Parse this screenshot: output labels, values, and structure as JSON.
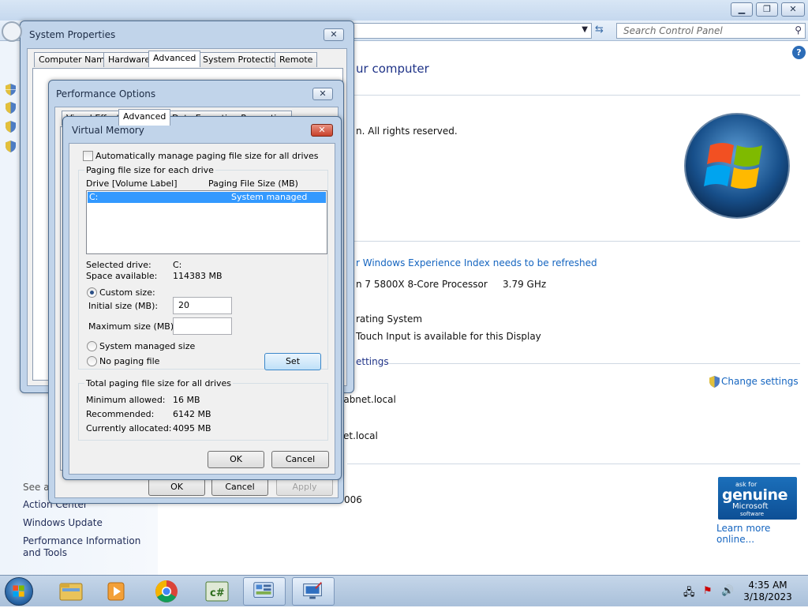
{
  "control_panel": {
    "search_placeholder": "Search Control Panel",
    "heading_fragment": "ur computer",
    "copyright_fragment": "n.  All rights reserved.",
    "wei_link_fragment": "r Windows Experience Index needs to be refreshed",
    "processor_fragment": "n 7 5800X 8-Core Processor",
    "processor_speed": "3.79 GHz",
    "os_fragment": "rating System",
    "touch_fragment": "Touch Input is available for this Display",
    "settings_fragment": "ettings",
    "change_settings": "Change settings",
    "domain_fragment_1": "labnet.local",
    "domain_fragment_2": "et.local",
    "product_id_fragment": "006",
    "left_see_also": "See al",
    "left_links": [
      "Action Center",
      "Windows Update",
      "Performance Information and Tools"
    ],
    "genuine": {
      "line1": "ask for",
      "line2": "genuine",
      "line3": "Microsoft",
      "line4": "software"
    },
    "learn_more": "Learn more online..."
  },
  "system_properties": {
    "title": "System Properties",
    "tabs": [
      "Computer Name",
      "Hardware",
      "Advanced",
      "System Protection",
      "Remote"
    ],
    "selected_tab": "Advanced"
  },
  "performance_options": {
    "title": "Performance Options",
    "tabs": [
      "Visual Effects",
      "Advanced",
      "Data Execution Prevention"
    ],
    "selected_tab": "Advanced",
    "buttons": {
      "ok": "OK",
      "cancel": "Cancel",
      "apply": "Apply"
    }
  },
  "virtual_memory": {
    "title": "Virtual Memory",
    "auto_manage_label": "Automatically manage paging file size for all drives",
    "auto_manage_checked": false,
    "paging_group_label": "Paging file size for each drive",
    "col_drive": "Drive  [Volume Label]",
    "col_size": "Paging File Size (MB)",
    "drives": [
      {
        "drive": "C:",
        "size": "System managed"
      }
    ],
    "selected_drive_label": "Selected drive:",
    "selected_drive_value": "C:",
    "space_available_label": "Space available:",
    "space_available_value": "114383 MB",
    "custom_size_label": "Custom size:",
    "initial_size_label": "Initial size (MB):",
    "initial_size_value": "20",
    "maximum_size_label": "Maximum size (MB):",
    "maximum_size_value": "",
    "system_managed_label": "System managed size",
    "no_paging_label": "No paging file",
    "set_button": "Set",
    "total_group_label": "Total paging file size for all drives",
    "minimum_label": "Minimum allowed:",
    "minimum_value": "16 MB",
    "recommended_label": "Recommended:",
    "recommended_value": "6142 MB",
    "allocated_label": "Currently allocated:",
    "allocated_value": "4095 MB",
    "ok_button": "OK",
    "cancel_button": "Cancel"
  },
  "taskbar": {
    "time": "4:35 AM",
    "date": "3/18/2023"
  },
  "colors": {
    "link": "#1565c0",
    "heading": "#1e3287",
    "selection": "#3399ff"
  }
}
